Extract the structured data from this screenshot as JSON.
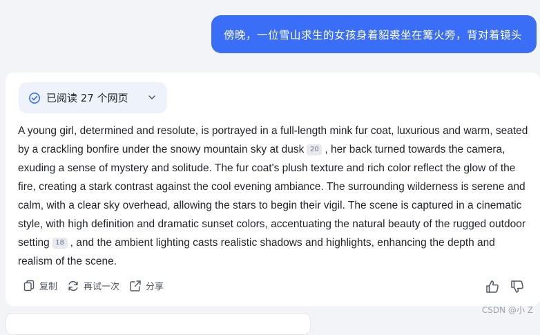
{
  "user_message": "傍晚，一位雪山求生的女孩身着貂裘坐在篝火旁，背对着镜头",
  "sources_chip": {
    "label": "已阅读 27 个网页"
  },
  "answer": {
    "part1": "A young girl, determined and resolute, is portrayed in a full-length mink fur coat, luxurious and warm, seated by a crackling bonfire under the snowy mountain sky at dusk",
    "cite1": "20",
    "part2": ", her back turned towards the camera, exuding a sense of mystery and solitude. The fur coat's plush texture and rich color reflect the glow of the fire, creating a stark contrast against the cool evening ambiance. The surrounding wilderness is serene and calm, with a clear sky overhead, allowing the stars to begin their vigil. The scene is captured in a cinematic style, with high definition and dramatic sunset colors, accentuating the natural beauty of the rugged outdoor setting",
    "cite2": "18",
    "part3": ", and the ambient lighting casts realistic shadows and highlights, enhancing the depth and realism of the scene."
  },
  "actions": {
    "copy": "复制",
    "retry": "再试一次",
    "share": "分享"
  },
  "watermark": "CSDN @小 Z",
  "colors": {
    "accent": "#3a6ef6",
    "card": "#ffffff",
    "background": "#f3f4f8"
  },
  "icons": [
    "check-circle-icon",
    "chevron-down-icon",
    "copy-icon",
    "refresh-icon",
    "share-icon",
    "thumbs-up-icon",
    "thumbs-down-icon"
  ]
}
